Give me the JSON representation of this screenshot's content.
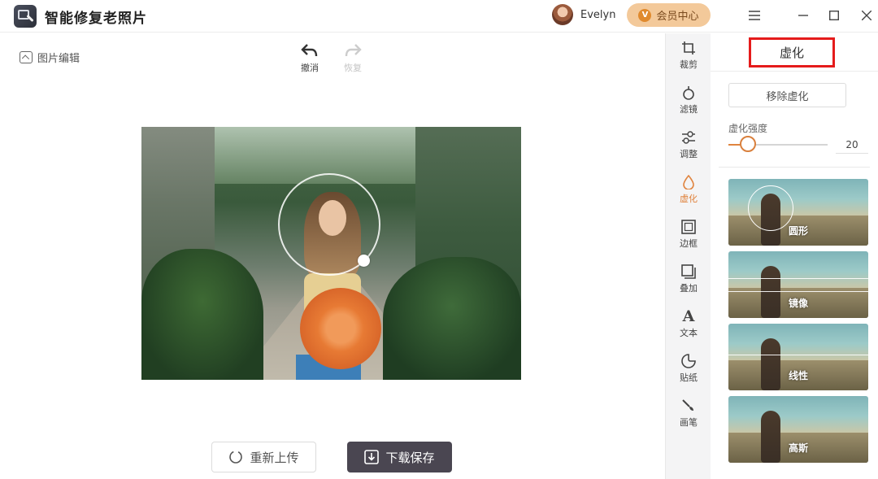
{
  "app": {
    "title": "智能修复老照片",
    "user_name": "Evelyn",
    "vip_label": "会员中心"
  },
  "workspace": {
    "edit_label": "图片编辑",
    "undo_label": "撤消",
    "redo_label": "恢复",
    "reupload_label": "重新上传",
    "save_label": "下载保存"
  },
  "tools": [
    {
      "label": "裁剪",
      "icon": "crop-icon"
    },
    {
      "label": "滤镜",
      "icon": "filter-icon"
    },
    {
      "label": "调整",
      "icon": "adjust-icon"
    },
    {
      "label": "虚化",
      "icon": "blur-icon"
    },
    {
      "label": "边框",
      "icon": "frame-icon"
    },
    {
      "label": "叠加",
      "icon": "overlay-icon"
    },
    {
      "label": "文本",
      "icon": "text-icon"
    },
    {
      "label": "贴纸",
      "icon": "sticker-icon"
    },
    {
      "label": "画笔",
      "icon": "brush-icon"
    }
  ],
  "active_tool": "虚化",
  "panel": {
    "title": "虚化",
    "remove_label": "移除虚化",
    "strength_label": "虚化强度",
    "strength_value": "20",
    "presets": [
      {
        "label": "圆形"
      },
      {
        "label": "镜像"
      },
      {
        "label": "线性"
      },
      {
        "label": "高斯"
      }
    ]
  },
  "colors": {
    "accent": "#e0843f",
    "highlight_border": "#e51b1b",
    "save_button": "#4a4651"
  }
}
